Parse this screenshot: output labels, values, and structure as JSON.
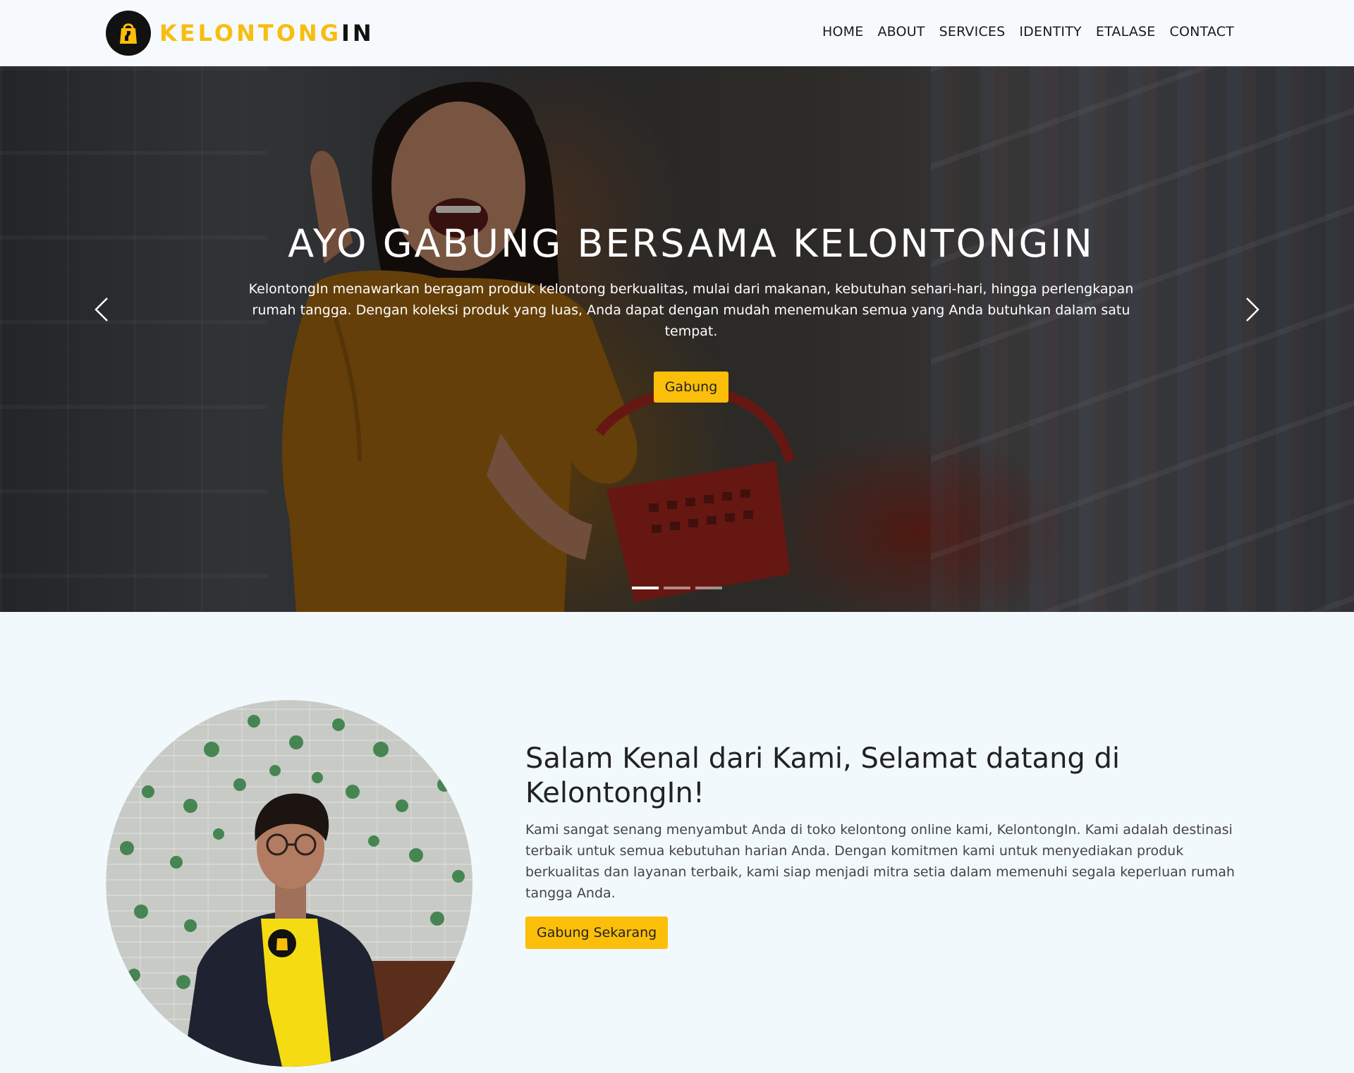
{
  "brand": {
    "name_part1": "KELONTONG",
    "name_part2": "IN",
    "icon": "shopping-bag-icon",
    "accent_color": "#fbbf0a"
  },
  "nav": {
    "items": [
      {
        "label": "HOME"
      },
      {
        "label": "ABOUT"
      },
      {
        "label": "SERVICES"
      },
      {
        "label": "IDENTITY"
      },
      {
        "label": "ETALASE"
      },
      {
        "label": "CONTACT"
      }
    ]
  },
  "hero": {
    "title": "AYO GABUNG BERSAMA KELONTONGIN",
    "text": "KelontongIn menawarkan beragam produk kelontong berkualitas, mulai dari makanan, kebutuhan sehari-hari, hingga perlengkapan rumah tangga. Dengan koleksi produk yang luas, Anda dapat dengan mudah menemukan semua yang Anda butuhkan dalam satu tempat.",
    "button_label": "Gabung",
    "prev_icon": "chevron-left-icon",
    "next_icon": "chevron-right-icon",
    "slide_count": 3,
    "active_slide": 1
  },
  "about": {
    "title": "Salam Kenal dari Kami, Selamat datang di KelontongIn!",
    "text": "Kami sangat senang menyambut Anda di toko kelontong online kami, KelontongIn. Kami adalah destinasi terbaik untuk semua kebutuhan harian Anda. Dengan komitmen kami untuk menyediakan produk berkualitas dan layanan terbaik, kami siap menjadi mitra setia dalam memenuhi segala keperluan rumah tangga Anda.",
    "button_label": "Gabung Sekarang"
  }
}
